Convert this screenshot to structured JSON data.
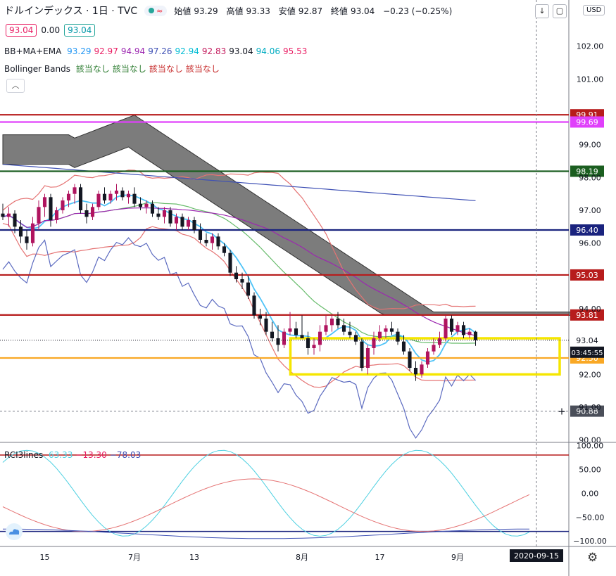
{
  "header": {
    "title": "ドルインデックス · 1日 · TVC",
    "ohlc": {
      "open_label": "始値",
      "open": "93.29",
      "high_label": "高値",
      "high": "93.33",
      "low_label": "安値",
      "low": "92.87",
      "close_label": "終値",
      "close": "93.04",
      "change": "−0.23 (−0.25%)"
    },
    "sell_price": "93.04",
    "spread": "0.00",
    "buy_price": "93.04",
    "status_dot_colors": [
      "#26a69a",
      "#e91e63"
    ]
  },
  "legends": {
    "bbmaema_name": "BB+MA+EMA",
    "bbmaema_values": [
      {
        "v": "93.29",
        "color": "#2196f3"
      },
      {
        "v": "92.97",
        "color": "#e91e63"
      },
      {
        "v": "94.94",
        "color": "#9c27b0"
      },
      {
        "v": "97.26",
        "color": "#3f51b5"
      },
      {
        "v": "92.94",
        "color": "#00bcd4"
      },
      {
        "v": "92.83",
        "color": "#c2185b"
      },
      {
        "v": "93.04",
        "color": "#131722"
      },
      {
        "v": "94.06",
        "color": "#00acc1"
      },
      {
        "v": "95.53",
        "color": "#e91e63"
      }
    ],
    "bb_name": "Bollinger Bands",
    "bb_values": [
      {
        "v": "該当なし",
        "color": "#2e7d32"
      },
      {
        "v": "該当なし",
        "color": "#2e7d32"
      },
      {
        "v": "該当なし",
        "color": "#c62828"
      },
      {
        "v": "該当なし",
        "color": "#c62828"
      }
    ],
    "rci_name": "RCI3lines",
    "rci_values": [
      {
        "v": "63.33",
        "color": "#4dd0e1"
      },
      {
        "v": "−13.30",
        "color": "#e91e63"
      },
      {
        "v": "−78.03",
        "color": "#3f51b5"
      }
    ]
  },
  "toolbar": {
    "currency": "USD",
    "collapse_icon": "chevron-up-icon",
    "down_icon": "arrow-down-icon",
    "fullscreen_icon": "square-icon",
    "settings_icon": "gear-icon",
    "logo_icon": "cloud-logo-icon"
  },
  "chart_data": {
    "type": "candlestick",
    "main_y_ticks": [
      "102.00",
      "101.00",
      "99.00",
      "98.00",
      "97.00",
      "96.00",
      "94.00",
      "92.00",
      "91.00",
      "90.00"
    ],
    "main_y_top_cut": "102.00",
    "ylim": [
      89.95,
      103.3
    ],
    "x_ticks": [
      {
        "label": "15",
        "i": 7
      },
      {
        "label": "7月",
        "i": 22
      },
      {
        "label": "13",
        "i": 32
      },
      {
        "label": "8月",
        "i": 50
      },
      {
        "label": "17",
        "i": 63
      },
      {
        "label": "9月",
        "i": 76
      }
    ],
    "current_date": "2020-09-15",
    "current_index": 88,
    "bars_count": 89,
    "candles": [
      [
        96.9,
        97.2,
        96.7,
        96.8
      ],
      [
        96.8,
        97.1,
        96.5,
        96.9
      ],
      [
        96.9,
        97.0,
        96.3,
        96.5
      ],
      [
        96.5,
        96.7,
        96.0,
        96.2
      ],
      [
        96.2,
        96.4,
        95.8,
        96.0
      ],
      [
        96.0,
        96.8,
        95.9,
        96.6
      ],
      [
        96.6,
        97.3,
        96.4,
        97.1
      ],
      [
        97.1,
        97.5,
        96.8,
        97.4
      ],
      [
        97.4,
        97.5,
        96.5,
        96.7
      ],
      [
        96.7,
        97.1,
        96.6,
        97.0
      ],
      [
        97.0,
        97.4,
        96.9,
        97.3
      ],
      [
        97.3,
        97.6,
        97.1,
        97.5
      ],
      [
        97.5,
        97.8,
        97.2,
        97.7
      ],
      [
        97.7,
        97.8,
        96.9,
        97.0
      ],
      [
        97.0,
        97.2,
        96.6,
        96.8
      ],
      [
        96.8,
        97.2,
        96.7,
        97.1
      ],
      [
        97.1,
        97.6,
        97.0,
        97.5
      ],
      [
        97.5,
        97.7,
        97.2,
        97.3
      ],
      [
        97.3,
        97.6,
        97.2,
        97.5
      ],
      [
        97.5,
        97.8,
        97.3,
        97.6
      ],
      [
        97.6,
        97.7,
        97.3,
        97.4
      ],
      [
        97.4,
        97.6,
        97.2,
        97.5
      ],
      [
        97.5,
        97.7,
        97.1,
        97.2
      ],
      [
        97.2,
        97.4,
        97.0,
        97.1
      ],
      [
        97.1,
        97.3,
        96.9,
        97.2
      ],
      [
        97.2,
        97.3,
        96.8,
        96.9
      ],
      [
        96.9,
        97.1,
        96.7,
        96.8
      ],
      [
        96.8,
        97.1,
        96.6,
        97.0
      ],
      [
        97.0,
        97.1,
        96.5,
        96.6
      ],
      [
        96.6,
        96.9,
        96.4,
        96.8
      ],
      [
        96.8,
        96.9,
        96.4,
        96.5
      ],
      [
        96.5,
        96.8,
        96.4,
        96.7
      ],
      [
        96.7,
        96.8,
        96.3,
        96.4
      ],
      [
        96.4,
        96.6,
        96.0,
        96.1
      ],
      [
        96.1,
        96.3,
        95.9,
        96.0
      ],
      [
        96.0,
        96.3,
        95.8,
        96.2
      ],
      [
        96.2,
        96.3,
        95.8,
        95.9
      ],
      [
        95.9,
        96.0,
        95.6,
        95.7
      ],
      [
        95.7,
        95.8,
        95.0,
        95.1
      ],
      [
        95.1,
        95.3,
        94.8,
        94.9
      ],
      [
        94.9,
        95.1,
        94.6,
        94.8
      ],
      [
        94.8,
        95.0,
        94.3,
        94.4
      ],
      [
        94.4,
        94.5,
        93.7,
        93.8
      ],
      [
        93.8,
        94.0,
        93.5,
        93.7
      ],
      [
        93.7,
        93.9,
        93.2,
        93.3
      ],
      [
        93.3,
        93.6,
        93.0,
        93.1
      ],
      [
        93.1,
        93.5,
        92.7,
        92.9
      ],
      [
        92.9,
        93.4,
        92.8,
        93.3
      ],
      [
        93.3,
        93.9,
        93.2,
        93.4
      ],
      [
        93.4,
        93.6,
        93.1,
        93.2
      ],
      [
        93.2,
        93.8,
        93.1,
        93.1
      ],
      [
        93.1,
        93.3,
        92.6,
        92.8
      ],
      [
        92.8,
        93.1,
        92.6,
        92.9
      ],
      [
        92.9,
        93.5,
        92.7,
        93.3
      ],
      [
        93.3,
        93.8,
        93.2,
        93.5
      ],
      [
        93.5,
        93.8,
        93.3,
        93.7
      ],
      [
        93.7,
        93.9,
        93.4,
        93.5
      ],
      [
        93.5,
        93.7,
        93.2,
        93.3
      ],
      [
        93.3,
        93.6,
        93.1,
        93.2
      ],
      [
        93.2,
        93.3,
        92.9,
        93.0
      ],
      [
        93.0,
        93.1,
        92.1,
        92.2
      ],
      [
        92.2,
        92.9,
        92.0,
        92.8
      ],
      [
        92.8,
        93.3,
        92.6,
        93.1
      ],
      [
        93.1,
        93.5,
        93.0,
        93.3
      ],
      [
        93.3,
        93.5,
        93.1,
        93.4
      ],
      [
        93.4,
        93.6,
        93.2,
        93.3
      ],
      [
        93.3,
        93.4,
        92.9,
        93.0
      ],
      [
        93.0,
        93.2,
        92.6,
        92.7
      ],
      [
        92.7,
        92.8,
        92.1,
        92.2
      ],
      [
        92.2,
        92.4,
        91.8,
        92.0
      ],
      [
        92.0,
        92.4,
        91.9,
        92.3
      ],
      [
        92.3,
        92.8,
        92.2,
        92.7
      ],
      [
        92.7,
        93.1,
        92.6,
        92.9
      ],
      [
        92.9,
        93.3,
        92.8,
        93.1
      ],
      [
        93.1,
        93.8,
        93.0,
        93.7
      ],
      [
        93.7,
        93.8,
        93.2,
        93.3
      ],
      [
        93.3,
        93.6,
        93.2,
        93.5
      ],
      [
        93.5,
        93.6,
        93.1,
        93.2
      ],
      [
        93.2,
        93.4,
        93.1,
        93.3
      ],
      [
        93.3,
        93.33,
        92.87,
        93.04
      ]
    ],
    "horizontal_levels": [
      {
        "price": 99.91,
        "label": "99.91",
        "color": "#b71c1c"
      },
      {
        "price": 99.69,
        "label": "99.69",
        "color": "#e040fb"
      },
      {
        "price": 98.19,
        "label": "98.19",
        "color": "#1b5e20"
      },
      {
        "price": 96.4,
        "label": "96.40",
        "color": "#1a237e"
      },
      {
        "price": 95.03,
        "label": "95.03",
        "color": "#b71c1c"
      },
      {
        "price": 93.81,
        "label": "93.81",
        "color": "#b71c1c"
      },
      {
        "price": 92.5,
        "label": "92.50",
        "color": "#f9a825"
      }
    ],
    "last_price": {
      "price": 93.04,
      "label": "93.04",
      "countdown": "03:45:55"
    },
    "crosshair": {
      "price": 90.88,
      "label": "90.88"
    },
    "highlight_box": {
      "x0": 93.1,
      "x1": 92.0,
      "i0": 49,
      "i1": 95,
      "color": "#f5e600"
    },
    "rci": {
      "y_ticks": [
        "100.00",
        "50.00",
        "0.00",
        "−50.00",
        "−100.00"
      ],
      "ylim": [
        -110,
        105
      ],
      "levels": [
        {
          "value": 80,
          "color": "#b71c1c"
        },
        {
          "value": -80,
          "color": "#1a237e"
        }
      ]
    }
  }
}
